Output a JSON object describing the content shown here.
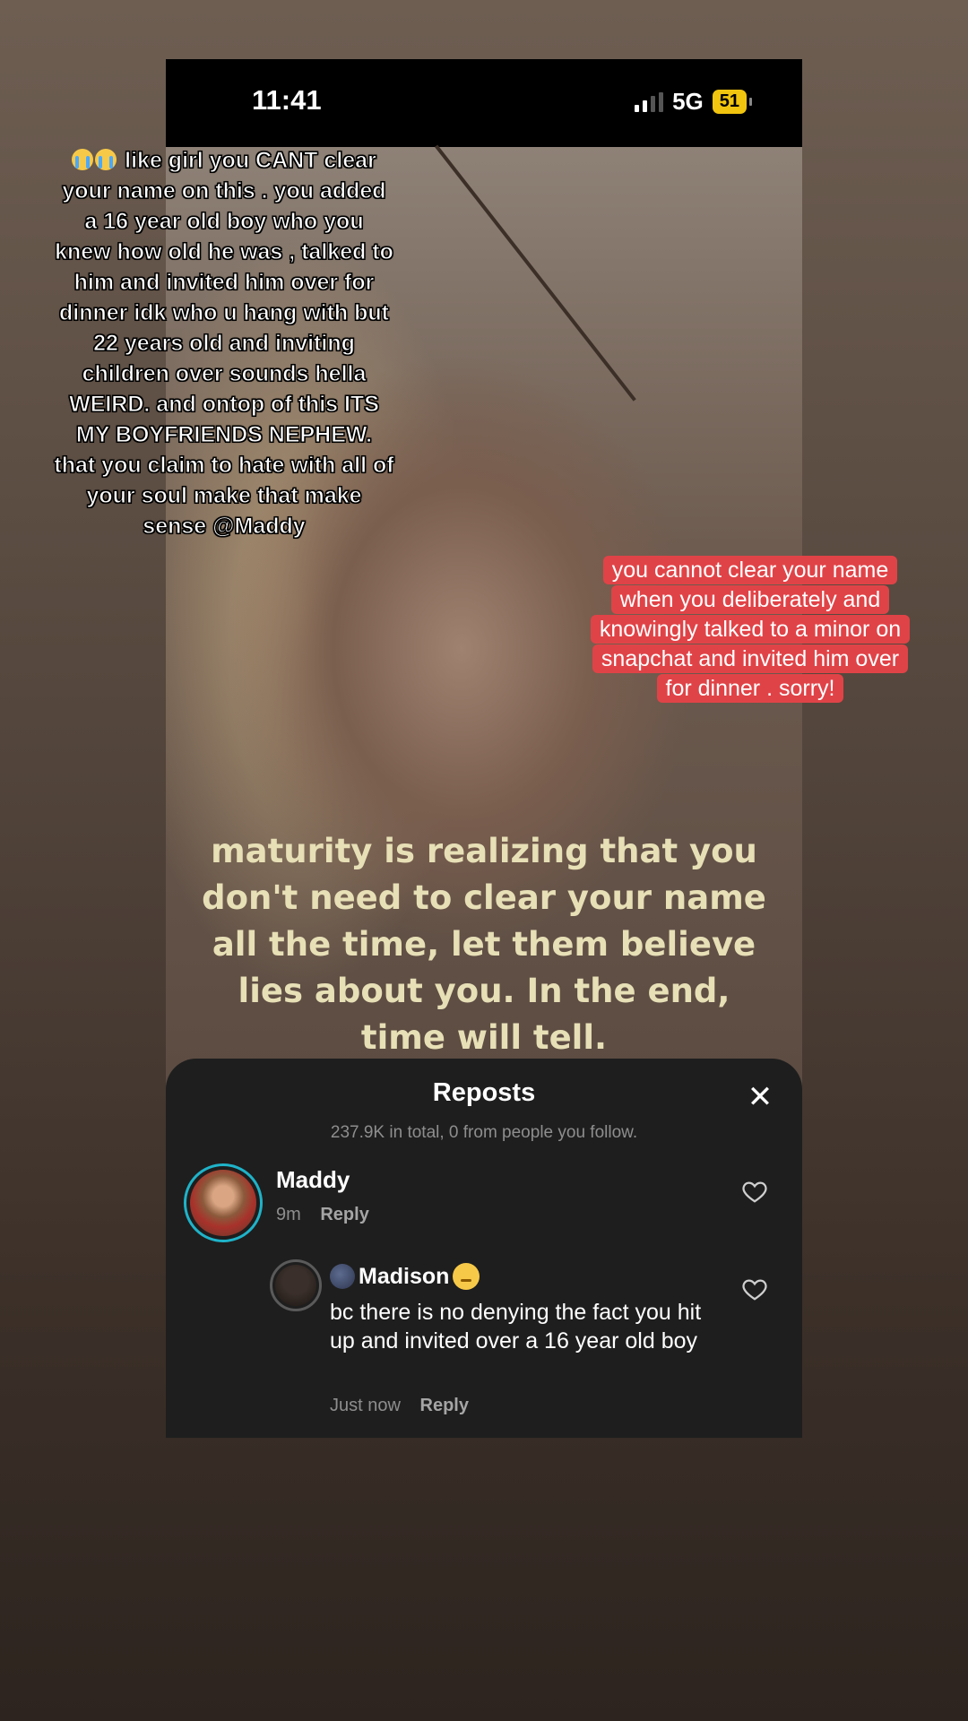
{
  "status_bar": {
    "time": "11:41",
    "network": "5G",
    "battery": "51",
    "signal_bars_filled": 2,
    "signal_bars_total": 4
  },
  "video": {
    "caption": "maturity is realizing that you don't need to clear your name all the time, let them believe lies about you. In the end, time will tell."
  },
  "overlay_left": {
    "emoji": "crying-face-icon x2",
    "text": "like girl you CANT clear your name on this . you added a 16 year old boy who you knew how old he was , talked to him and invited him over for dinner idk who u hang with but 22 years old and inviting children over sounds hella WEIRD. and ontop of this ITS MY BOYFRIENDS NEPHEW. that you claim to hate with all of your soul make that make sense @Maddy"
  },
  "overlay_right": {
    "text": "you cannot clear your name when you deliberately and knowingly talked to a minor on snapchat and invited him over for dinner . sorry!",
    "background_color": "#e04347"
  },
  "reposts_sheet": {
    "title": "Reposts",
    "subtitle": "237.9K in total, 0 from people you follow.",
    "close_label": "✕",
    "comments": [
      {
        "name": "Maddy",
        "time": "9m",
        "reply_label": "Reply"
      },
      {
        "name": "Madison",
        "name_emoji_left": "moon-icon",
        "name_emoji_right": "smiley-icon",
        "text": "bc there is no denying the fact you hit up and invited over a 16 year old boy",
        "time": "Just now",
        "reply_label": "Reply"
      }
    ]
  }
}
